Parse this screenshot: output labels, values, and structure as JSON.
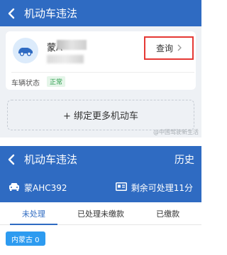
{
  "screen1": {
    "nav": {
      "title": "机动车违法"
    },
    "vehicle": {
      "plate_prefix": "蒙A"
    },
    "query_label": "查询",
    "status": {
      "label": "车辆状态",
      "value": "正常"
    },
    "bind_more_label": "+ 绑定更多机动车",
    "watermark": "@中国驾驶新生活"
  },
  "screen2": {
    "nav": {
      "title": "机动车违法",
      "history": "历史"
    },
    "plate": "蒙AHC392",
    "remaining": "剩余可处理11分",
    "tabs": [
      "未处理",
      "已处理未缴款",
      "已缴款"
    ],
    "active_tab": 0,
    "region_chip": "内蒙古 0"
  },
  "colors": {
    "primary": "#2f6bc2",
    "highlight_border": "#e53935",
    "status_green": "#2e9f4f",
    "chip_blue": "#2d9bf0"
  }
}
